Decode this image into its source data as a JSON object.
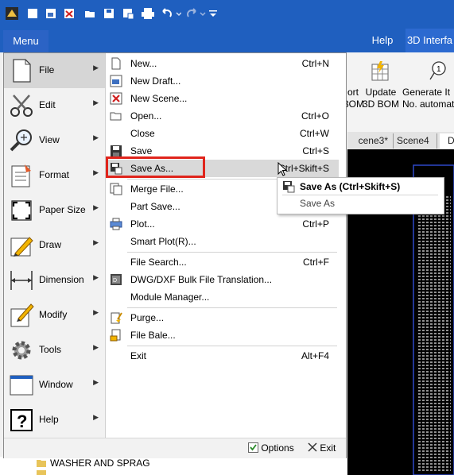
{
  "ribbon": {
    "tabs": [
      "Help",
      "3D Interfa"
    ],
    "buttons": [
      {
        "line1": "ort",
        "line2": "3OM"
      },
      {
        "line1": "Update",
        "line2": "3D BOM"
      },
      {
        "line1": "Generate It",
        "line2": "No. automat"
      }
    ]
  },
  "scene_tabs": [
    "cene3*",
    "Scene4",
    "D"
  ],
  "menu": {
    "button_label": "Menu",
    "categories": [
      "File",
      "Edit",
      "View",
      "Format",
      "Paper Size",
      "Draw",
      "Dimension",
      "Modify",
      "Tools",
      "Window",
      "Help"
    ],
    "items": [
      {
        "label": "New...",
        "shortcut": "Ctrl+N",
        "icon": "new-file-icon"
      },
      {
        "label": "New Draft...",
        "shortcut": "",
        "icon": "new-draft-icon"
      },
      {
        "label": "New Scene...",
        "shortcut": "",
        "icon": "new-scene-icon"
      },
      {
        "label": "Open...",
        "shortcut": "Ctrl+O",
        "icon": "open-folder-icon"
      },
      {
        "label": "Close",
        "shortcut": "Ctrl+W",
        "icon": ""
      },
      {
        "label": "Save",
        "shortcut": "Ctrl+S",
        "icon": "save-icon"
      },
      {
        "label": "Save As...",
        "shortcut": "Ctrl+Skift+S",
        "icon": "save-as-icon"
      },
      {
        "label": "Merge File...",
        "shortcut": "",
        "icon": "merge-file-icon"
      },
      {
        "label": "Part Save...",
        "shortcut": "",
        "icon": ""
      },
      {
        "label": "Plot...",
        "shortcut": "Ctrl+P",
        "icon": "plot-icon"
      },
      {
        "label": "Smart Plot(R)...",
        "shortcut": "",
        "icon": ""
      },
      {
        "label": "File Search...",
        "shortcut": "Ctrl+F",
        "icon": ""
      },
      {
        "label": "DWG/DXF Bulk File Translation...",
        "shortcut": "",
        "icon": "dwg-icon"
      },
      {
        "label": "Module Manager...",
        "shortcut": "",
        "icon": ""
      },
      {
        "label": "Purge...",
        "shortcut": "",
        "icon": "purge-icon"
      },
      {
        "label": "File Bale...",
        "shortcut": "",
        "icon": "file-bale-icon"
      },
      {
        "label": "Exit",
        "shortcut": "Alt+F4",
        "icon": ""
      }
    ],
    "options_label": "Options",
    "exit_label": "Exit"
  },
  "tooltip": {
    "title": "Save As (Ctrl+Skift+S)",
    "description": "Save As"
  },
  "tree": {
    "item": "WASHER AND SPRAG"
  },
  "colors": {
    "title_bar": "#1f5fbf",
    "menu_button": "#2b63c5",
    "highlight_border": "#e0241b"
  }
}
